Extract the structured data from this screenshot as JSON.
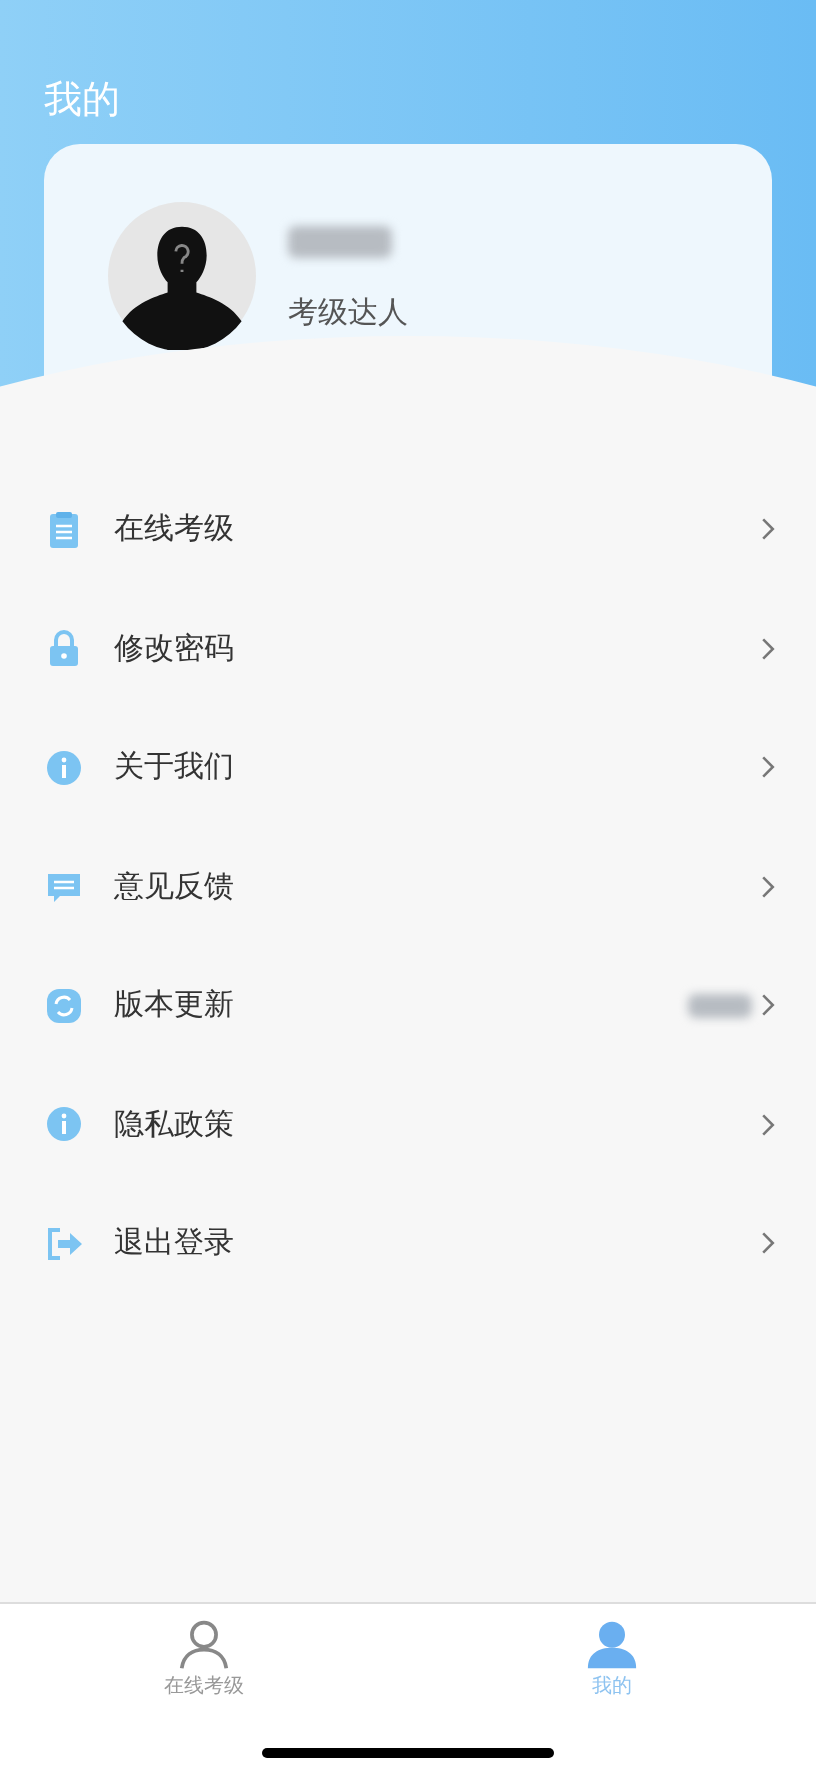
{
  "header": {
    "title": "我的"
  },
  "profile": {
    "subtitle": "考级达人"
  },
  "menu": [
    {
      "kind": "clipboard",
      "label": "在线考级"
    },
    {
      "kind": "lock",
      "label": "修改密码"
    },
    {
      "kind": "info",
      "label": "关于我们"
    },
    {
      "kind": "message",
      "label": "意见反馈"
    },
    {
      "kind": "refresh",
      "label": "版本更新",
      "redacted_value": true
    },
    {
      "kind": "info",
      "label": "隐私政策"
    },
    {
      "kind": "exit",
      "label": "退出登录"
    }
  ],
  "tabs": [
    {
      "label": "在线考级",
      "selected": false
    },
    {
      "label": "我的",
      "selected": true
    }
  ]
}
